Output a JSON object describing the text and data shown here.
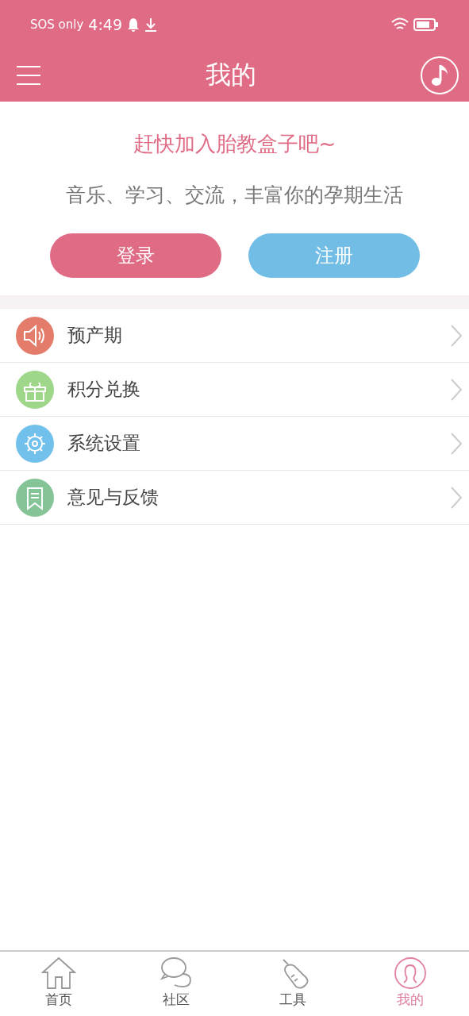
{
  "status_bar": {
    "carrier": "SOS only",
    "time": "4:49"
  },
  "header": {
    "title": "我的"
  },
  "promo": {
    "headline": "赶快加入胎教盒子吧~",
    "subtitle": "音乐、学习、交流，丰富你的孕期生活",
    "buttons": [
      {
        "kind": "login",
        "label": "登录"
      },
      {
        "kind": "register",
        "label": "注册"
      }
    ]
  },
  "menu": [
    {
      "kind": "speaker",
      "label": "预产期"
    },
    {
      "kind": "gift",
      "label": "积分兑换"
    },
    {
      "kind": "gear",
      "label": "系统设置"
    },
    {
      "kind": "bookmark",
      "label": "意见与反馈"
    }
  ],
  "tabs": [
    {
      "kind": "home",
      "label": "首页",
      "selected": false
    },
    {
      "kind": "chat",
      "label": "社区",
      "selected": false
    },
    {
      "kind": "bottle",
      "label": "工具",
      "selected": false
    },
    {
      "kind": "person",
      "label": "我的",
      "selected": true
    }
  ]
}
